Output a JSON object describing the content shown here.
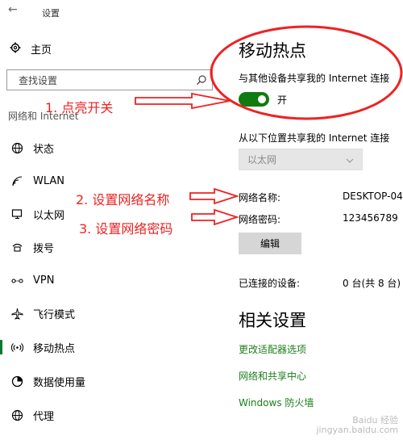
{
  "window": {
    "back_glyph": "←",
    "title": "设置"
  },
  "sidebar": {
    "home_label": "主页",
    "search_placeholder": "查找设置",
    "section_header": "网络和 Internet",
    "items": [
      {
        "label": "状态",
        "icon": "globe-icon"
      },
      {
        "label": "WLAN",
        "icon": "wifi-icon"
      },
      {
        "label": "以太网",
        "icon": "ethernet-icon"
      },
      {
        "label": "拨号",
        "icon": "dialup-icon"
      },
      {
        "label": "VPN",
        "icon": "vpn-icon"
      },
      {
        "label": "飞行模式",
        "icon": "airplane-icon"
      },
      {
        "label": "移动热点",
        "icon": "hotspot-icon",
        "active": true
      },
      {
        "label": "数据使用量",
        "icon": "data-usage-icon"
      },
      {
        "label": "代理",
        "icon": "globe-icon"
      }
    ]
  },
  "main": {
    "title": "移动热点",
    "share_label": "与其他设备共享我的 Internet 连接",
    "toggle_state": "开",
    "share_from_label": "从以下位置共享我的 Internet 连接",
    "share_from_value": "以太网",
    "network_name_label": "网络名称:",
    "network_name_value": "DESKTOP-04",
    "network_password_label": "网络密码:",
    "network_password_value": "123456789",
    "edit_button": "编辑",
    "connected_label": "已连接的设备:",
    "connected_value": "0 台(共 8 台)",
    "related_title": "相关设置",
    "links": [
      "更改适配器选项",
      "网络和共享中心",
      "Windows 防火墙"
    ]
  },
  "annotations": {
    "step1": "1.  点亮开关",
    "step2": "2.  设置网络名称",
    "step3": "3.  设置网络密码",
    "color": "#ee2222"
  },
  "watermark": {
    "line1": "Baidu 经验",
    "line2": "jingyan.baidu.com"
  },
  "colors": {
    "accent": "#107c10",
    "link": "#1a7f1a",
    "annotation": "#ee2222"
  }
}
